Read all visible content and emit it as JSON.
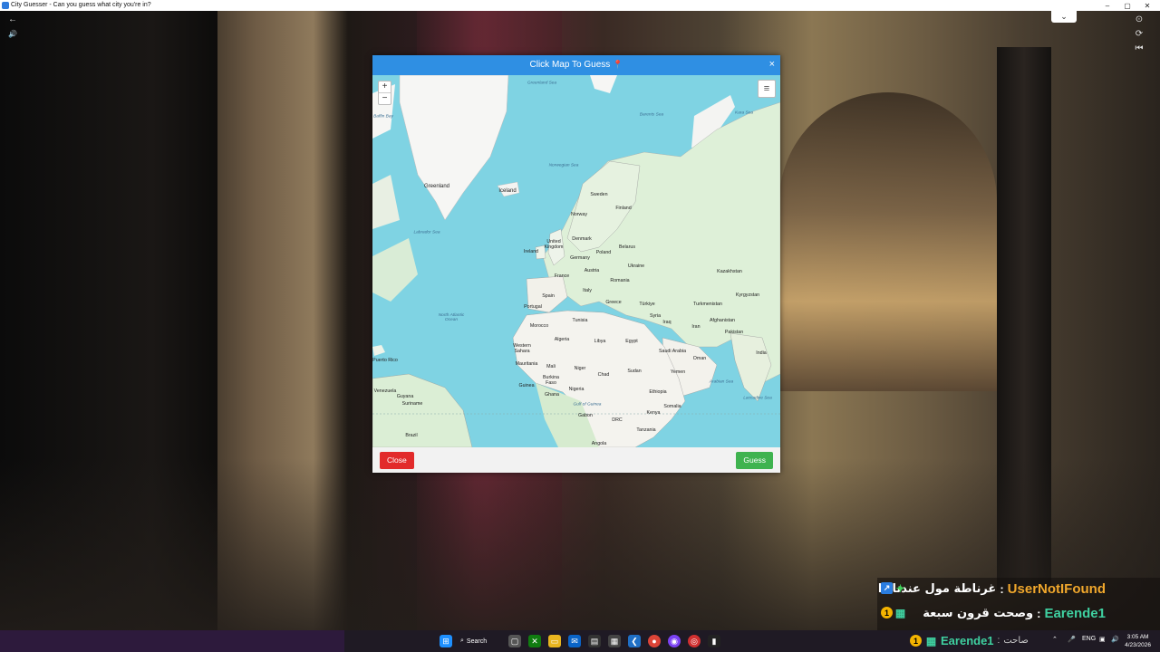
{
  "window": {
    "title": "City Guesser - Can you guess what city you're in?",
    "controls": {
      "minimize": "–",
      "maximize": "▢",
      "close": "✕"
    }
  },
  "streetview": {
    "back_icon": "←",
    "sound_icon": "🔊",
    "collapse_icon": "⌄",
    "right_controls": [
      "⊙",
      "⟳",
      "⏮"
    ]
  },
  "modal": {
    "title": "Click Map To Guess",
    "pin_icon": "📍",
    "close_x": "×",
    "zoom_in": "+",
    "zoom_out": "−",
    "layers_icon": "≡",
    "close_button": "Close",
    "guess_button": "Guess"
  },
  "map_labels": {
    "seas": [
      "Greenland Sea",
      "Barents Sea",
      "Kara Sea",
      "Baffin Bay",
      "Norwegian Sea",
      "Labrador Sea",
      "North Atlantic Ocean",
      "Arabian Sea",
      "Laccadive Sea",
      "Gulf of Guinea"
    ],
    "countries": [
      "Greenland",
      "Iceland",
      "Sweden",
      "Finland",
      "Norway",
      "Denmark",
      "United Kingdom",
      "Ireland",
      "Poland",
      "Belarus",
      "Germany",
      "France",
      "Austria",
      "Ukraine",
      "Kazakhstan",
      "Spain",
      "Portugal",
      "Italy",
      "Romania",
      "Greece",
      "Türkiye",
      "Turkmenistan",
      "Kyrgyzstan",
      "Syria",
      "Iraq",
      "Iran",
      "Afghanistan",
      "Pakistan",
      "Morocco",
      "Tunisia",
      "Algeria",
      "Libya",
      "Egypt",
      "Saudi Arabia",
      "Oman",
      "India",
      "Western Sahara",
      "Mauritania",
      "Mali",
      "Niger",
      "Chad",
      "Sudan",
      "Yemen",
      "Burkina Faso",
      "Guinea",
      "Ghana",
      "Nigeria",
      "Ethiopia",
      "Somalia",
      "Gabon",
      "DRC",
      "Kenya",
      "Tanzania",
      "Angola",
      "Puerto Rico",
      "Venezuela",
      "Guyana",
      "Suriname",
      "Brazil"
    ]
  },
  "chat": [
    {
      "message": "غرناطة مول عندنا ذا",
      "separator": ":",
      "user": "UserNotIFound",
      "badges": [
        "↗",
        "✦"
      ]
    },
    {
      "message": "وصحت قرون سبعة",
      "separator": ":",
      "user": "Earende1",
      "badges": [
        "1",
        "▦"
      ]
    }
  ],
  "taskbar": {
    "search_label": "Search",
    "chat_user": "Earende1",
    "chat_separator": ":",
    "chat_message": "صاحت",
    "language": "ENG",
    "time": "3:05 AM",
    "date": "4/23/2026"
  }
}
